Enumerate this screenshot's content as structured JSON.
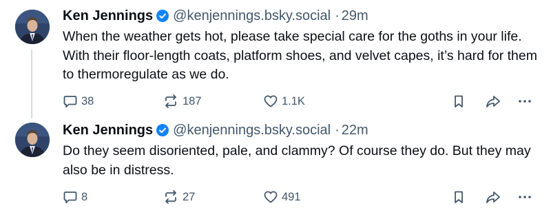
{
  "posts": [
    {
      "author": "Ken Jennings",
      "handle": "@kenjennings.bsky.social",
      "separator": "·",
      "time": "29m",
      "text": "When the weather gets hot, please take special care for the goths in your life. With their floor-length coats, platform shoes, and velvet capes, it’s hard for them to thermoregulate as we do.",
      "replies": "38",
      "reposts": "187",
      "likes": "1.1K"
    },
    {
      "author": "Ken Jennings",
      "handle": "@kenjennings.bsky.social",
      "separator": "·",
      "time": "22m",
      "text": "Do they seem disoriented, pale, and clammy? Of course they do. But they may also be in distress.",
      "replies": "8",
      "reposts": "27",
      "likes": "491"
    }
  ],
  "icons": {
    "verified": "verified-badge-icon",
    "reply": "speech-bubble-icon",
    "repost": "repost-arrows-icon",
    "like": "heart-icon",
    "bookmark": "bookmark-icon",
    "share": "share-arrow-icon",
    "more": "ellipsis-icon"
  },
  "colors": {
    "text": "#0b0f14",
    "muted": "#42576c",
    "verified": "#1083fe",
    "thread_line": "#d4dbe2"
  }
}
